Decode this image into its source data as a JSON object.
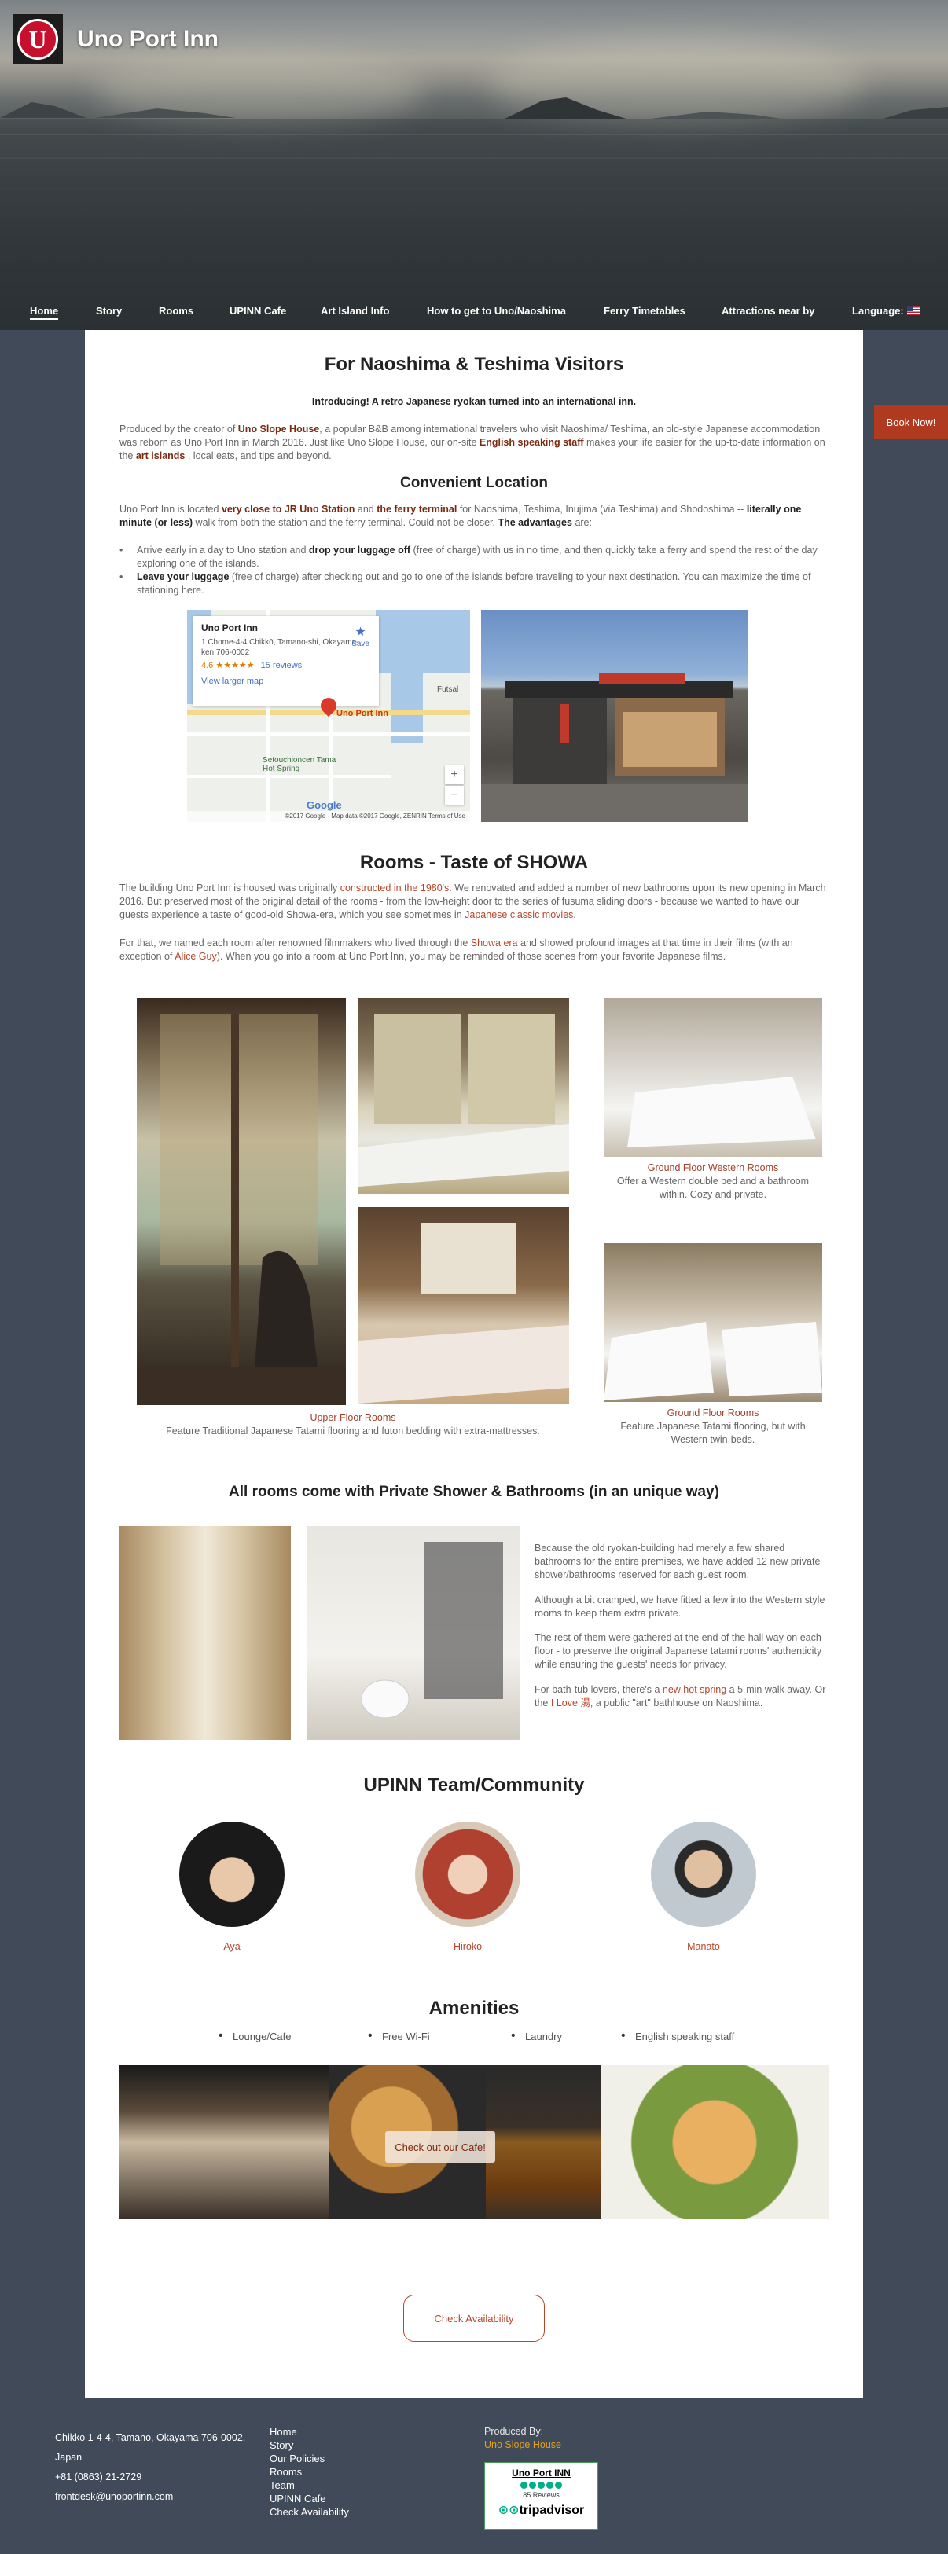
{
  "brand": {
    "logo_letter": "U",
    "name": "Uno Port Inn"
  },
  "nav": [
    {
      "label": "Home",
      "active": true
    },
    {
      "label": "Story"
    },
    {
      "label": "Rooms"
    },
    {
      "label": "UPINN Cafe"
    },
    {
      "label": "Art Island Info"
    },
    {
      "label": "How to get to Uno/Naoshima"
    },
    {
      "label": "Ferry Timetables"
    },
    {
      "label": "Attractions near by"
    },
    {
      "label": "Language:"
    }
  ],
  "book_now": "Book Now!",
  "intro": {
    "title": "For Naoshima & Teshima Visitors",
    "subtitle": "Introducing! A retro Japanese ryokan turned into an international inn.",
    "p1_a": "Produced by the creator of ",
    "p1_b": "Uno Slope House",
    "p1_c": ", a popular B&B among international travelers who visit Naoshima/ Teshima, an old-style Japanese accommodation was reborn as Uno Port Inn in March 2016. Just like Uno Slope House, our on-site ",
    "p1_d": "English speaking staff",
    "p1_e": " makes your life easier for the up-to-date information on the ",
    "p1_f": "art islands",
    "p1_g": " , local eats, and tips and beyond."
  },
  "location": {
    "title": "Convenient Location",
    "p_a": "Uno Port Inn is located ",
    "p_b": "very close to JR Uno Station",
    "p_c": " and ",
    "p_d": "the ferry terminal",
    "p_e": " for Naoshima, Teshima, Inujima (via Teshima) and Shodoshima  --",
    "p_f": " literally one minute (or less)",
    "p_g": " walk from both the station and the ferry terminal. Could not be closer. ",
    "p_h": "The advantages",
    "p_i": " are:",
    "b1_a": "Arrive early in a day to Uno station and ",
    "b1_b": "drop your luggage off",
    "b1_c": " (free of charge) with us in no time, and then quickly take a ferry and spend the rest of the day exploring one of the islands.",
    "b2_a": "Leave your luggage",
    "b2_b": " (free of charge) after checking out and go to one of the islands before traveling to your next destination.  You can maximize the time of stationing here."
  },
  "map": {
    "place": "Uno Port Inn",
    "address": "1 Chome-4-4 Chikkō, Tamano-shi, Okayama-ken 706-0002",
    "rating": "4.6 ★★★★★",
    "reviews": "15 reviews",
    "link": "View larger map",
    "save": "Save",
    "pin_label": "Uno Port Inn",
    "label_spring": "Setouchioncen Tama Hot Spring",
    "label_futsal": "Futsal",
    "footer": "©2017 Google - Map data ©2017 Google, ZENRIN   Terms of Use",
    "google": "Google"
  },
  "rooms": {
    "title": "Rooms - Taste of SHOWA",
    "p1_a": "The building Uno Port Inn is housed was originally ",
    "p1_b": "constructed in the 1980's",
    "p1_c": ". We renovated and added a number of new bathrooms upon its new opening in March 2016. But preserved most of the original detail of the rooms - from the low-height door to the series of fusuma sliding doors - because we wanted to have our guests experience a taste of good-old Showa-era, which you see sometimes in ",
    "p1_d": "Japanese classic movies",
    "p1_e": ".",
    "p2_a": "For that, we named each room after renowned filmmakers who lived through the ",
    "p2_b": "Showa era",
    "p2_c": " and showed profound images at that time in their films (with an exception of ",
    "p2_d": "Alice Guy",
    "p2_e": ").   When you go into a room at Uno Port Inn, you may be reminded of those scenes from your favorite Japanese films.",
    "upper_title": "Upper Floor Rooms",
    "upper_desc": "Feature Traditional Japanese Tatami flooring and futon bedding with extra-mattresses.",
    "western_title": "Ground Floor Western Rooms",
    "western_desc": "Offer a Western double bed and a bathroom within. Cozy and private.",
    "ground_title": "Ground Floor Rooms",
    "ground_desc": "Feature Japanese Tatami flooring, but with Western twin-beds."
  },
  "bath": {
    "title": "All rooms come with Private Shower & Bathrooms (in an unique way)",
    "p1": "Because the old ryokan-building had merely a few shared bathrooms for the entire premises, we have added 12 new private shower/bathrooms reserved for each guest room.",
    "p2": "Although a bit cramped, we have fitted a few into the Western style rooms to keep them extra private.",
    "p3": "The rest of them were gathered at the end of the hall way on each floor - to preserve the original Japanese tatami rooms' authenticity while ensuring the guests' needs for privacy.",
    "p4_a": "For bath-tub lovers, there's a ",
    "p4_b": "new hot spring",
    "p4_c": " a 5-min walk away. Or the ",
    "p4_d": "I Love 湯",
    "p4_e": ", a public \"art\" bathhouse on Naoshima."
  },
  "team": {
    "title": "UPINN Team/Community",
    "members": [
      "Aya",
      "Hiroko",
      "Manato"
    ]
  },
  "amenities": {
    "title": "Amenities",
    "items": [
      "Lounge/Cafe",
      "Free Wi-Fi",
      "Laundry",
      "English speaking staff"
    ],
    "cafe_button": "Check out our Cafe!"
  },
  "check_availability": "Check Availability",
  "footer": {
    "address1": "Chikko 1-4-4, Tamano, Okayama 706-0002,",
    "address2": "Japan",
    "phone": "+81 (0863) 21-2729",
    "email": "frontdesk@unoportinn.com",
    "links": [
      "Home",
      "Story",
      "Our Policies",
      "Rooms",
      "Team",
      "UPINN Cafe",
      "Check Availability"
    ],
    "produced_by": "Produced By:",
    "producer": "Uno Slope House",
    "ta_name": "Uno Port INN",
    "ta_reviews": "85 Reviews",
    "ta_logo_a": "⊙⊙",
    "ta_logo_b": "tripadvisor"
  },
  "colors": {
    "accent": "#b8452a",
    "page_bg": "#404a58",
    "book_now": "#b03a20",
    "tripadvisor": "#00af87"
  }
}
